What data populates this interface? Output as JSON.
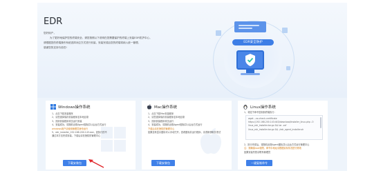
{
  "header": {
    "title": "EDR",
    "intro_greeting": "您好用户，",
    "intro_lines": [
      "为了更好地保护您的终端安全，请您按照以下说明在您需要保护的终端上安装EDR防护中心，",
      "请根据您的终端操作系统选择对应方式进行安装，安装完成后您的终端将纳入统一管理，",
      "感谢您的支持与信任!"
    ],
    "illustration_label": "EDR安全防护"
  },
  "panels": [
    {
      "title": "Windows操作系统",
      "icon": "windows-icon",
      "steps": [
        "1、点击下载安装程序",
        "2、请您选择保存安装程序至本地目录",
        "3、找到安装程序双击运行安装",
        "4、安装成功，将随机出现Agent图标并以后台方式运行",
        "windows用户请使用管理员身份运行",
        "5、edr_installer_192.168.200.143.exe，如执行的不",
        "通过本方法完成安装，下载后请在授权的管理中心"
      ],
      "button": "下载安装包"
    },
    {
      "title": "Mac操作系统",
      "icon": "apple-icon",
      "steps": [
        "1、点击下载Mac安装程序",
        "2、请您选择保存安装程序至本地目录",
        "3、找到安装程序双击运行",
        "4、安装成功，将随机出现Agent图标并以后台方式运行",
        "下载后请在授权的管理中心",
        "如果没有显示图标可以手动打开，查看图标并运行程序，请重新获取并重试"
      ],
      "button": "下载安装包"
    },
    {
      "title": "Linux操作系统",
      "icon": "linux-icon",
      "step1": "1、将如下命令复制到终端执行：",
      "commands": [
        "wget --no-check-certificate",
        "https://192.168.200.143:443/download/installer_linux.php -O",
        "linux_edr_installer.tar.gz && tar -zxf",
        "linux_edr_installer.tar.gz && ./edr_agent_installer.sh"
      ],
      "step2": "2、执行完成后，将随机出现Agent图标并以后台方式运行管理中心",
      "warn": "注：需确保root权限，命令中地址请根据实际情况进行修改",
      "extra": "如果安装失败请联系管理员",
      "button": "一键复制命令"
    }
  ],
  "colors": {
    "accent": "#3f80e8",
    "page_bg": "#eef4fb",
    "warn": "#d47b12",
    "arrow": "#e0262b"
  }
}
